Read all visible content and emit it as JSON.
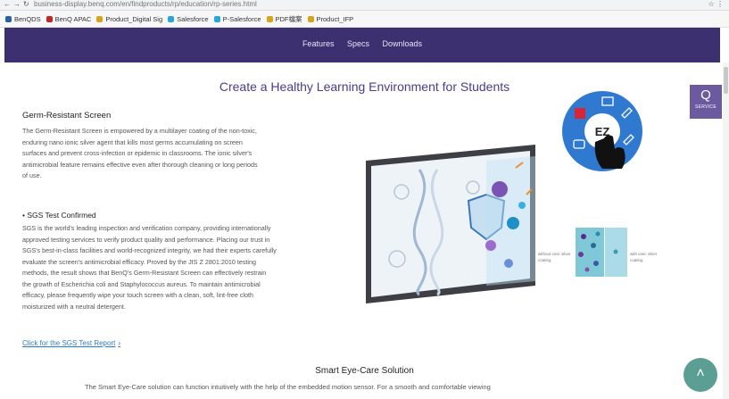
{
  "browser": {
    "url": "business-display.benq.com/en/findproducts/rp/education/rp-series.html",
    "bookmarks": [
      {
        "label": "BenQDS",
        "color": "#2b5fa8"
      },
      {
        "label": "BenQ APAC",
        "color": "#c0272d"
      },
      {
        "label": "Product_Digital Sig",
        "color": "#d9a21b"
      },
      {
        "label": "Salesforce",
        "color": "#2aa4dc"
      },
      {
        "label": "P-Salesforce",
        "color": "#2aa4dc"
      },
      {
        "label": "PDF檔案",
        "color": "#d9a21b"
      },
      {
        "label": "Product_IFP",
        "color": "#d9a21b"
      }
    ]
  },
  "nav": {
    "links": [
      "Features",
      "Specs",
      "Downloads"
    ]
  },
  "main": {
    "headline": "Create a Healthy Learning Environment for Students",
    "germ_title": "Germ-Resistant Screen",
    "germ_lines": [
      "The Germ-Resistant Screen is empowered by a multilayer coating of the non-toxic,",
      "enduring nano ionic silver agent that kills most germs accumulating on screen",
      "surfaces and prevent cross-infection or epidemic in classrooms. The ionic silver's",
      "antimicrobial feature remains effective even after thorough cleaning or long periods",
      "of use."
    ],
    "sgs_title": "• SGS Test Confirmed",
    "sgs_lines": [
      "SGS is the world's leading inspection and verification company, providing internationally",
      "approved testing services to verify product quality and performance. Placing our trust in",
      "SGS's best-in-class facilities and world-recognized integrity, we had their experts carefully",
      "evaluate the screen's antimicrobial efficacy. Proved by the JIS Z 2801:2010 testing",
      "methods, the result shows that BenQ's Germ-Resistant Screen can effectively restrain",
      "the growth of Escherichia coli and Staphylococcus aureus. To maintain antimicrobial",
      "efficacy, please frequently wipe your touch screen with a clean, soft, lint-free cloth",
      "moisturized with a neutral detergent."
    ],
    "report_link": "Click for the SGS Test Report",
    "report_arrow": "›",
    "eyecare_title": "Smart Eye-Care Solution",
    "eyecare_text": "The Smart Eye-Care solution can function intuitively with the help of the embedded motion sensor. For a smooth and comfortable viewing",
    "sample_before": "without ionic silver coating",
    "sample_after": "with ionic silver coating",
    "ez_label": "EZ"
  },
  "service": {
    "letter": "Q",
    "label": "SERVICE"
  },
  "to_top": "˄"
}
